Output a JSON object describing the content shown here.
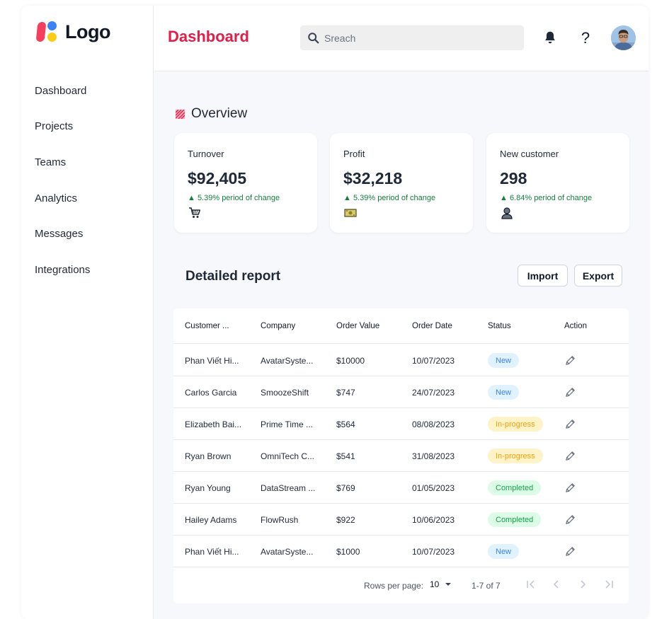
{
  "brand": {
    "name": "Logo"
  },
  "sidebar": {
    "items": [
      {
        "label": "Dashboard"
      },
      {
        "label": "Projects"
      },
      {
        "label": "Teams"
      },
      {
        "label": "Analytics"
      },
      {
        "label": "Messages"
      },
      {
        "label": "Integrations"
      }
    ]
  },
  "header": {
    "title": "Dashboard",
    "search_placeholder": "Sreach",
    "help_label": "?"
  },
  "overview": {
    "title": "Overview",
    "cards": [
      {
        "label": "Turnover",
        "value": "$92,405",
        "change": "▲ 5.39% period of change",
        "icon": "shopping-cart-icon"
      },
      {
        "label": "Profit",
        "value": "$32,218",
        "change": "▲ 5.39% period of change",
        "icon": "money-icon"
      },
      {
        "label": "New customer",
        "value": "298",
        "change": "▲ 6.84% period of change",
        "icon": "person-icon"
      }
    ]
  },
  "report": {
    "title": "Detailed report",
    "import_label": "Import",
    "export_label": "Export",
    "columns": [
      "Customer ...",
      "Company",
      "Order Value",
      "Order Date",
      "Status",
      "Action"
    ],
    "rows": [
      {
        "customer": "Phan Viết Hi...",
        "company": "AvatarSyste...",
        "value": "$10000",
        "date": "10/07/2023",
        "status": "New"
      },
      {
        "customer": "Carlos Garcia",
        "company": "SmoozeShift",
        "value": "$747",
        "date": "24/07/2023",
        "status": "New"
      },
      {
        "customer": "Elizabeth Bai...",
        "company": "Prime Time ...",
        "value": "$564",
        "date": "08/08/2023",
        "status": "In-progress"
      },
      {
        "customer": "Ryan Brown",
        "company": "OmniTech C...",
        "value": "$541",
        "date": "31/08/2023",
        "status": "In-progress"
      },
      {
        "customer": "Ryan Young",
        "company": "DataStream ...",
        "value": "$769",
        "date": "01/05/2023",
        "status": "Completed"
      },
      {
        "customer": "Hailey Adams",
        "company": "FlowRush",
        "value": "$922",
        "date": "10/06/2023",
        "status": "Completed"
      },
      {
        "customer": "Phan Viết Hi...",
        "company": "AvatarSyste...",
        "value": "$1000",
        "date": "10/07/2023",
        "status": "New"
      }
    ],
    "status_colors": {
      "New": {
        "bg": "#e0f2fe",
        "fg": "#3b82f6"
      },
      "In-progress": {
        "bg": "#fef3c7",
        "fg": "#f59e0b"
      },
      "Completed": {
        "bg": "#dcfce7",
        "fg": "#16a34a"
      }
    },
    "pagination": {
      "rows_per_page_label": "Rows per page:",
      "rows_per_page": "10",
      "range": "1-7 of 7"
    }
  },
  "colors": {
    "accent": "#e11d48",
    "positive": "#15803d"
  }
}
